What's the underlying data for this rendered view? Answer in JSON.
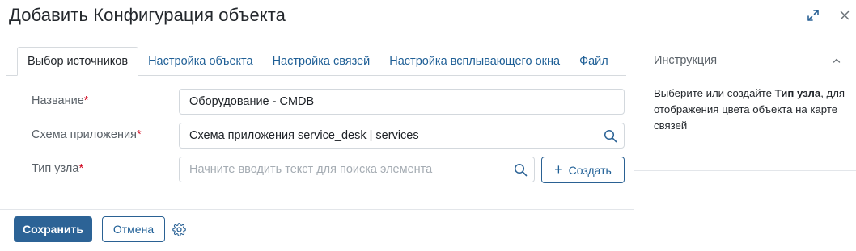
{
  "dialog": {
    "title": "Добавить Конфигурация объекта"
  },
  "tabs": [
    {
      "label": "Выбор источников",
      "active": true
    },
    {
      "label": "Настройка объекта",
      "active": false
    },
    {
      "label": "Настройка связей",
      "active": false
    },
    {
      "label": "Настройка всплывающего окна",
      "active": false
    },
    {
      "label": "Файл",
      "active": false
    }
  ],
  "form": {
    "name": {
      "label": "Название",
      "required_mark": "*",
      "value": "Оборудование - CMDB"
    },
    "schema": {
      "label": "Схема приложения",
      "required_mark": "*",
      "value": "Схема приложения service_desk | services"
    },
    "node_type": {
      "label": "Тип узла",
      "required_mark": "*",
      "placeholder": "Начните вводить текст для поиска элемента"
    },
    "create_label": "Создать"
  },
  "footer": {
    "save_label": "Сохранить",
    "cancel_label": "Отмена"
  },
  "instructions": {
    "title": "Инструкция",
    "text_before": "Выберите или создайте ",
    "text_bold": "Тип узла",
    "text_after": ", для отображения цвета объекта на карте связей"
  },
  "colors": {
    "primary": "#2c6396",
    "link": "#1f5f96",
    "required": "#d0021b",
    "border": "#d3d8dd"
  }
}
